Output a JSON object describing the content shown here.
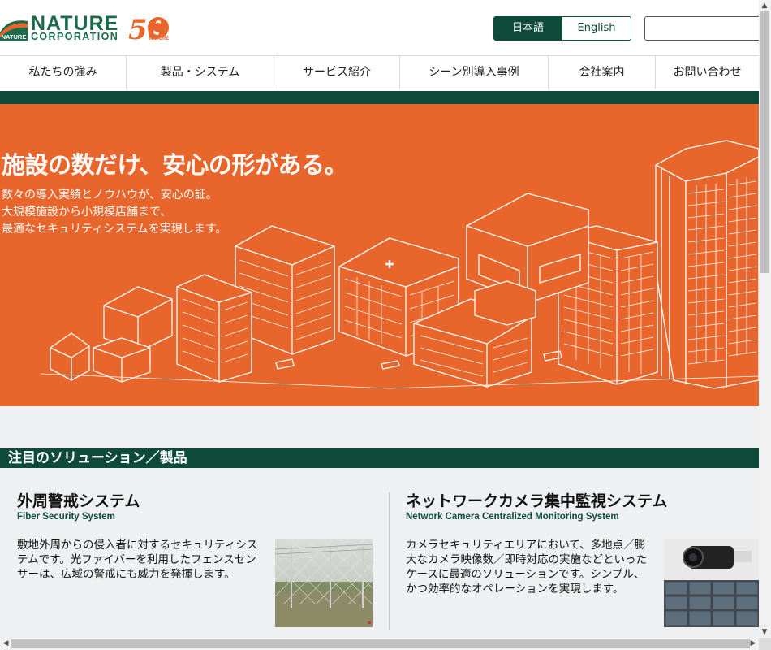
{
  "brand": {
    "name_line1": "NATURE",
    "name_line2": "CORPORATION",
    "mark_text": "NATURE",
    "anniversary": "50",
    "anniversary_mark_text": "NATURE"
  },
  "language": {
    "japanese": "日本語",
    "english": "English"
  },
  "search": {
    "value": "",
    "placeholder": ""
  },
  "nav": [
    {
      "label": "私たちの強み"
    },
    {
      "label": "製品・システム"
    },
    {
      "label": "サービス紹介"
    },
    {
      "label": "シーン別導入事例"
    },
    {
      "label": "会社案内"
    },
    {
      "label": "お問い合わせ"
    }
  ],
  "hero": {
    "title": "施設の数だけ、安心の形がある。",
    "lines": [
      "数々の導入実績とノウハウが、安心の証。",
      "大規模施設から小規模店舗まで、",
      "最適なセキュリティシステムを実現します。"
    ]
  },
  "featured": {
    "heading": "注目のソリューション／製品",
    "cards": [
      {
        "title": "外周警戒システム",
        "subtitle": "Fiber Security System",
        "description": "敷地外周からの侵入者に対するセキュリティシステムです。光ファイバーを利用したフェンスセンサーは、広域の警戒にも威力を発揮します。",
        "image": "fence-photo"
      },
      {
        "title": "ネットワークカメラ集中監視システム",
        "subtitle": "Network Camera Centralized Monitoring System",
        "description": "カメラセキュリティエリアにおいて、多地点／膨大なカメラ映像数／即時対応の実施などといったケースに最適のソリューションです。シンプル、かつ効率的なオペレーションを実現します。",
        "image": "camera-photo"
      }
    ]
  },
  "colors": {
    "brand_green": "#0e4a3a",
    "hero_orange": "#e8662c",
    "logo_green": "#1b6b4b",
    "accent_orange": "#e8662c"
  }
}
